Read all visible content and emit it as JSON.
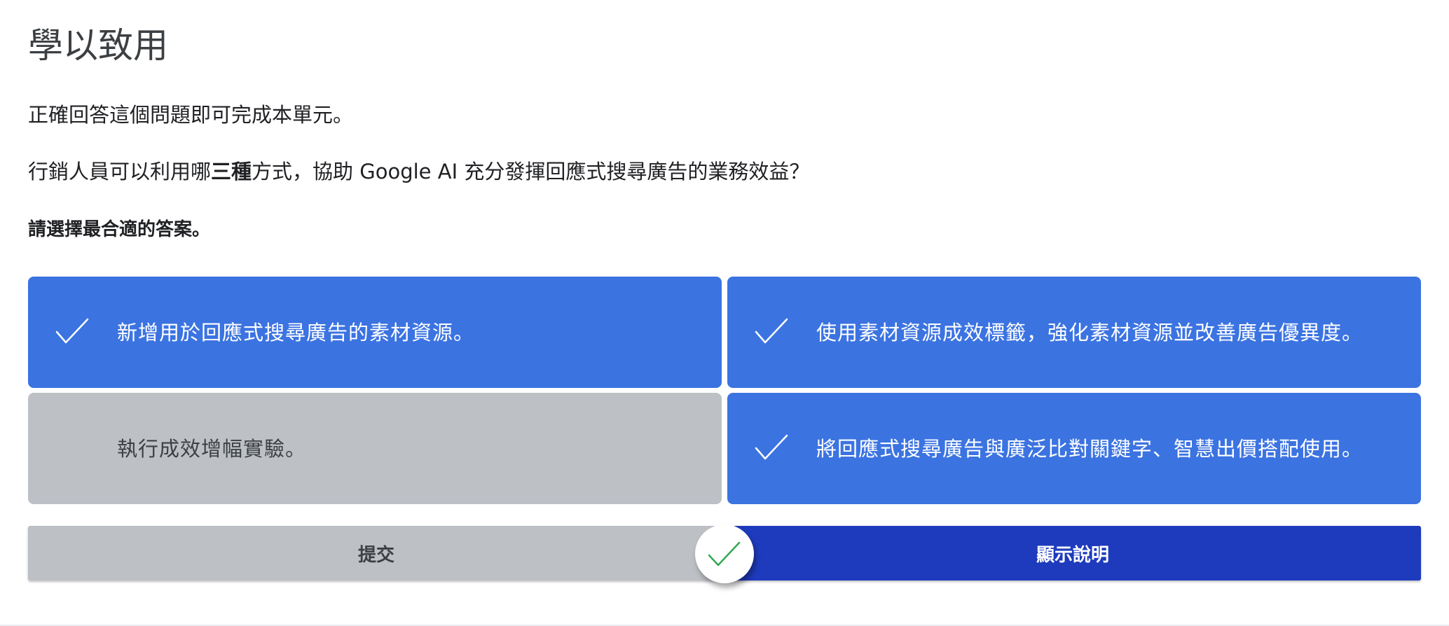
{
  "header": {
    "title": "學以致用"
  },
  "instruction": "正確回答這個問題即可完成本單元。",
  "question": {
    "before": "行銷人員可以利用哪",
    "emphasis": "三種",
    "after": "方式，協助 Google AI 充分發揮回應式搜尋廣告的業務效益？"
  },
  "prompt": "請選擇最合適的答案。",
  "options": [
    {
      "label": "新增用於回應式搜尋廣告的素材資源。",
      "selected": true,
      "icon": "check-icon"
    },
    {
      "label": "使用素材資源成效標籤，強化素材資源並改善廣告優異度。",
      "selected": true,
      "icon": "check-icon"
    },
    {
      "label": "執行成效增幅實驗。",
      "selected": false,
      "icon": ""
    },
    {
      "label": "將回應式搜尋廣告與廣泛比對關鍵字、智慧出價搭配使用。",
      "selected": true,
      "icon": "check-icon"
    }
  ],
  "buttons": {
    "submit_label": "提交",
    "explain_label": "顯示說明"
  },
  "status": {
    "icon": "check-icon",
    "state": "correct"
  },
  "colors": {
    "selected_option": "#3b73e1",
    "unselected_option": "#bdc1c6",
    "explain_button": "#1e3bbd",
    "submit_button": "#bdc1c6",
    "status_check": "#34a853"
  }
}
